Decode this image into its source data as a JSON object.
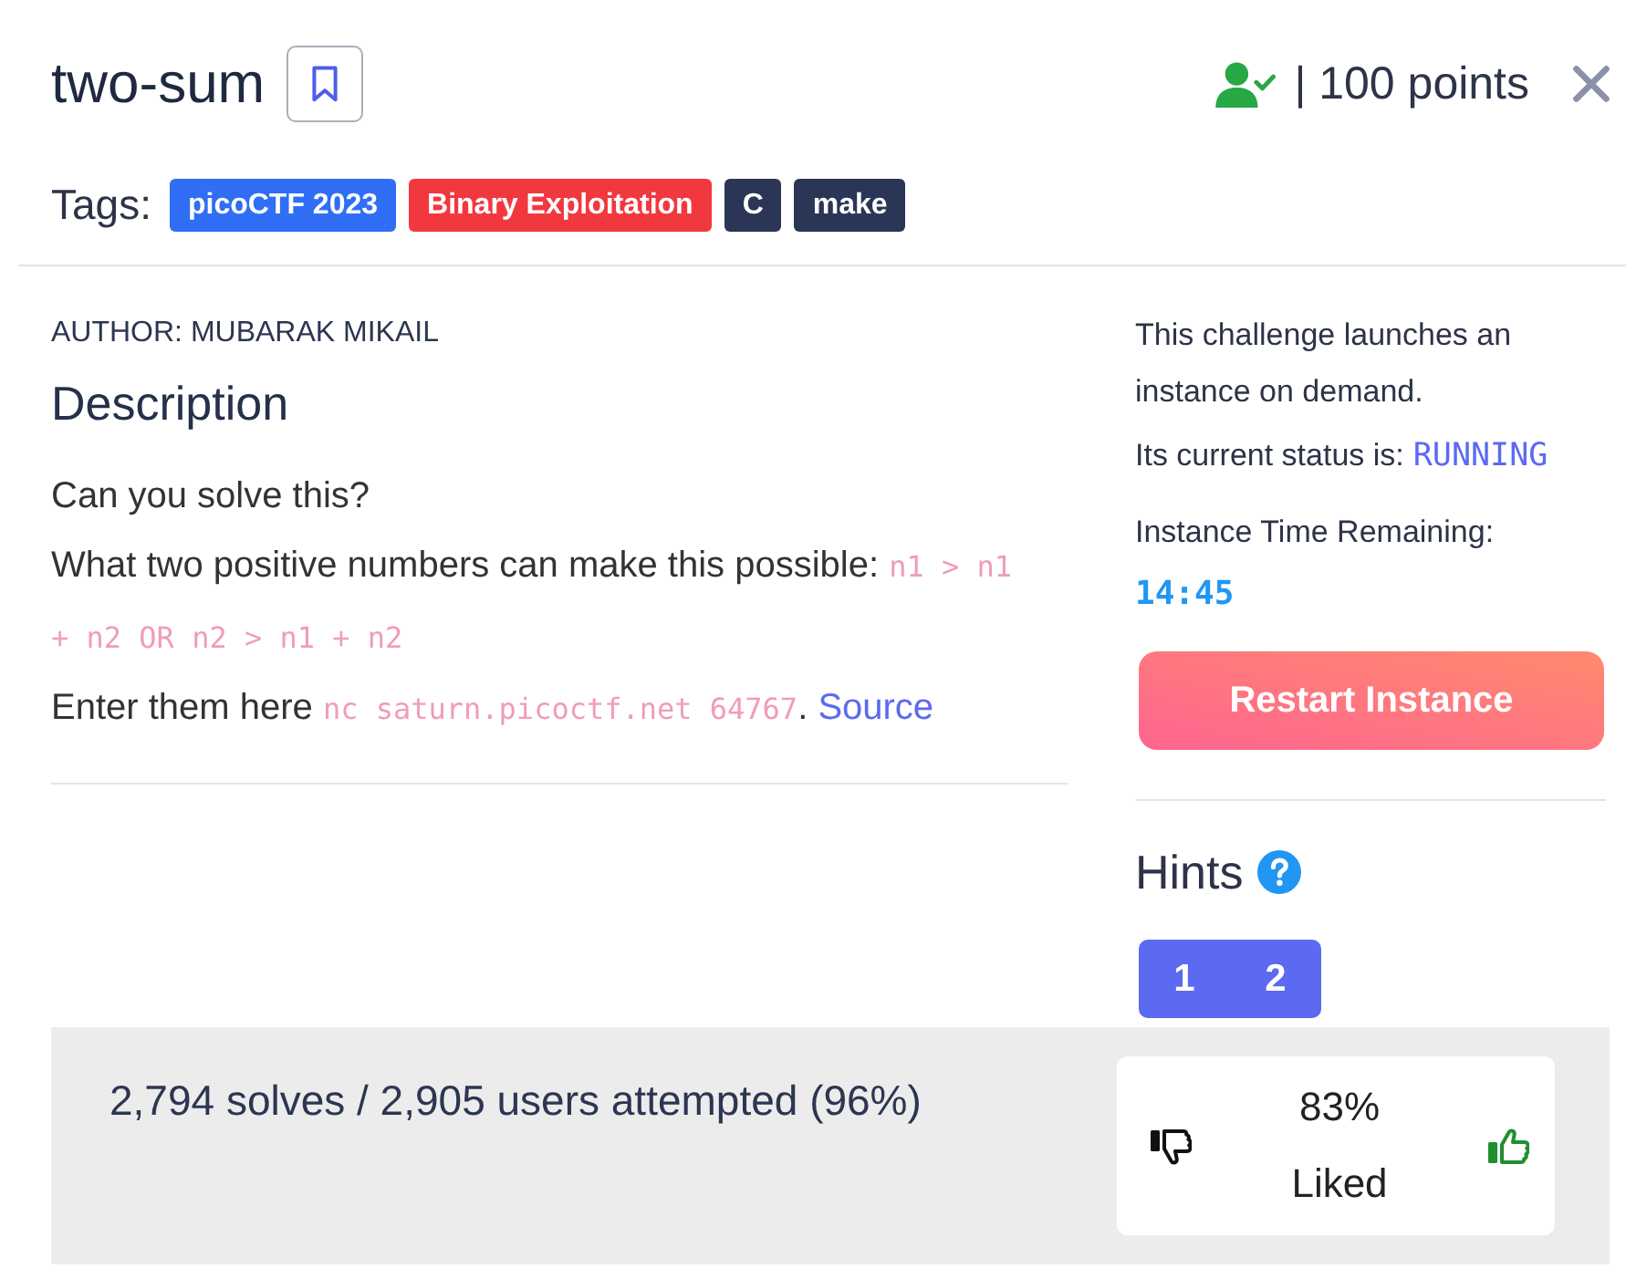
{
  "challenge": {
    "title": "two-sum",
    "bookmarked": false,
    "solved": true,
    "points": "| 100 points"
  },
  "tags_label": "Tags:",
  "tags": [
    {
      "label": "picoCTF 2023",
      "color": "#2f6ef5"
    },
    {
      "label": "Binary Exploitation",
      "color": "#f2383f"
    },
    {
      "label": "C",
      "color": "#2b3656"
    },
    {
      "label": "make",
      "color": "#2b3656"
    }
  ],
  "author": "AUTHOR: MUBARAK MIKAIL",
  "description": {
    "heading": "Description",
    "paragraphs": [
      [
        {
          "kind": "text",
          "text": "Can you solve this?"
        }
      ],
      [
        {
          "kind": "text",
          "text": "What two positive numbers can make this possible: "
        },
        {
          "kind": "code",
          "text": "n1 > n1 + n2 OR n2 > n1 + n2"
        }
      ],
      [
        {
          "kind": "text",
          "text": "Enter them here "
        },
        {
          "kind": "code",
          "text": "nc saturn.picoctf.net 64767"
        },
        {
          "kind": "text",
          "text": ". "
        },
        {
          "kind": "link",
          "text": "Source"
        }
      ]
    ]
  },
  "instance": {
    "intro": "This challenge launches an instance on demand.",
    "status_label": "Its current status is:",
    "status": "RUNNING",
    "time_label": "Instance Time Remaining:",
    "time_remaining": "14:45",
    "restart_button": "Restart Instance"
  },
  "hints": {
    "title": "Hints",
    "buttons": [
      "1",
      "2"
    ]
  },
  "stats": {
    "solves": "2,794 solves / 2,905 users attempted (96%)",
    "liked_percent": "83%",
    "liked_label": "Liked"
  }
}
